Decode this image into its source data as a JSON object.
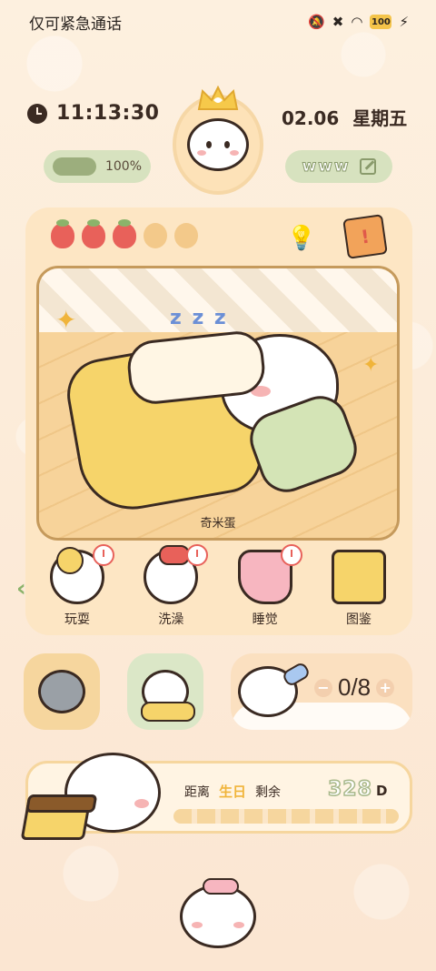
{
  "status_bar": {
    "carrier": "仅可紧急通话",
    "battery": "100"
  },
  "header": {
    "time": "11:13:30",
    "date": "02.06",
    "weekday": "星期五",
    "progress": {
      "label": "100%",
      "value": 1.0
    },
    "pet_name": "www"
  },
  "card": {
    "fruits": [
      "strawberry",
      "strawberry",
      "strawberry",
      "empty",
      "empty"
    ],
    "scene_caption": "奇米蛋",
    "scene_zzz": "z z z",
    "actions": [
      {
        "label": "玩耍",
        "icon": "play-art"
      },
      {
        "label": "洗澡",
        "icon": "bath-art"
      },
      {
        "label": "睡觉",
        "icon": "sleep-art"
      },
      {
        "label": "图鉴",
        "icon": "book-art"
      }
    ]
  },
  "feeding": {
    "count": "0/8",
    "minus": "−",
    "plus": "+"
  },
  "birthday": {
    "prefix": "距离",
    "highlight": "生日",
    "suffix": "剩余",
    "days": "328",
    "unit": "D"
  },
  "colors": {
    "background": "#fdeee0",
    "accent_green": "#d7e2bf",
    "accent_yellow": "#f6d46a",
    "strawberry": "#e8615a"
  }
}
